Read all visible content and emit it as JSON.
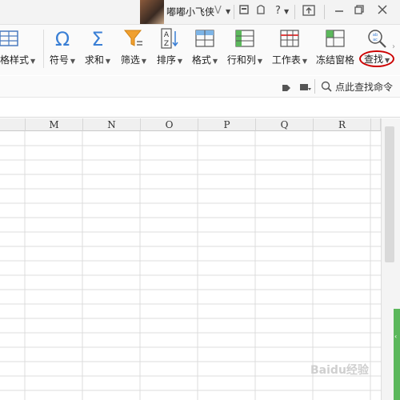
{
  "titlebar": {
    "user_name": "嘟嘟小飞侠",
    "vip_icon": "V",
    "help_label": "?"
  },
  "ribbon": {
    "partial_label": "格样式",
    "items": [
      {
        "name": "symbol",
        "label": "符号",
        "icon": "omega-icon"
      },
      {
        "name": "sum",
        "label": "求和",
        "icon": "sigma-icon"
      },
      {
        "name": "filter",
        "label": "筛选",
        "icon": "funnel-icon"
      },
      {
        "name": "sort",
        "label": "排序",
        "icon": "sort-az-icon"
      },
      {
        "name": "format",
        "label": "格式",
        "icon": "grid-format-icon"
      },
      {
        "name": "rowcol",
        "label": "行和列",
        "icon": "rows-cols-icon"
      },
      {
        "name": "worksheet",
        "label": "工作表",
        "icon": "worksheet-icon"
      },
      {
        "name": "freeze",
        "label": "冻结窗格",
        "icon": "freeze-pane-icon"
      },
      {
        "name": "find",
        "label": "查找",
        "icon": "find-magnifier-icon",
        "highlight_color": "#cc0000"
      }
    ]
  },
  "cmdbar": {
    "search_label": "点此查找命令"
  },
  "columns": [
    "M",
    "N",
    "O",
    "P",
    "Q",
    "R"
  ],
  "watermark": "Baidu经验"
}
